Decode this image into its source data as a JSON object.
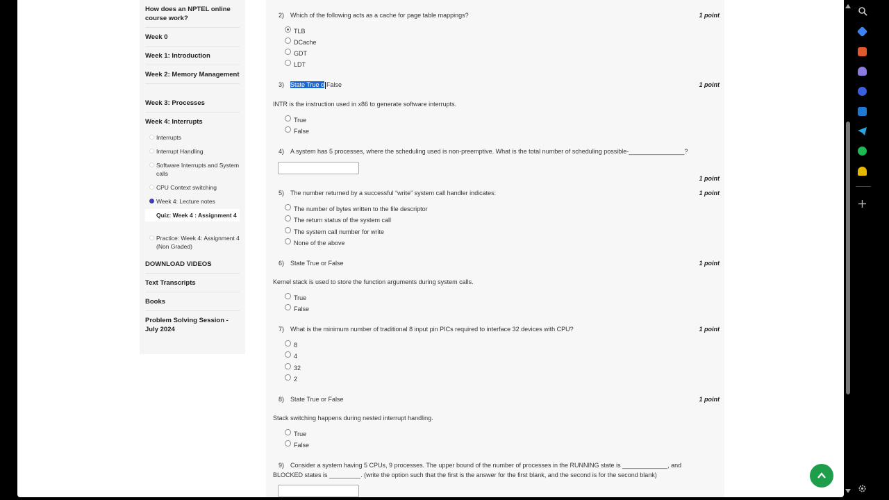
{
  "sidebar": {
    "items": [
      {
        "label": "How does an NPTEL online course work?"
      },
      {
        "label": "Week 0"
      },
      {
        "label": "Week 1: Introduction"
      },
      {
        "label": "Week 2: Memory Management"
      },
      {
        "label": "Week 3: Processes"
      },
      {
        "label": "Week 4: Interrupts"
      }
    ],
    "week4_subitems": [
      {
        "label": "Interrupts"
      },
      {
        "label": "Interrupt Handling"
      },
      {
        "label": "Software Interrupts and System calls"
      },
      {
        "label": "CPU Context switching"
      },
      {
        "label": "Week 4: Lecture notes"
      },
      {
        "label": "Quiz: Week 4 : Assignment 4"
      },
      {
        "label": "Practice: Week 4: Assignment 4 (Non Graded)"
      }
    ],
    "bottom_items": [
      {
        "label": "DOWNLOAD VIDEOS"
      },
      {
        "label": "Text Transcripts"
      },
      {
        "label": "Books"
      },
      {
        "label": "Problem Solving Session - July 2024"
      }
    ]
  },
  "questions": [
    {
      "num": "2)",
      "text": "Which of the following acts as a cache for page table mappings?",
      "points": "1 point",
      "options": [
        "TLB",
        "DCache",
        "GDT",
        "LDT"
      ]
    },
    {
      "num": "3)",
      "text_highlight": "State True o",
      "text_rest": "False",
      "points": "1 point",
      "statement": "INTR is the instruction used in x86 to generate software interrupts.",
      "options": [
        "True",
        "False"
      ]
    },
    {
      "num": "4)",
      "text": "A system has 5 processes, where the scheduling used is non-preemptive. What is the total number of scheduling possible-________________?",
      "points": "1 point"
    },
    {
      "num": "5)",
      "text": "The number returned by a successful “write” system call handler indicates:",
      "points": "1 point",
      "options": [
        "The number of bytes written to the file descriptor",
        "The return status of the system call",
        "The system call number for write",
        "None of the above"
      ]
    },
    {
      "num": "6)",
      "text": "State True or False",
      "points": "1 point",
      "statement": "Kernel stack is used to store the function arguments during system calls.",
      "options": [
        "True",
        "False"
      ]
    },
    {
      "num": "7)",
      "text": "What is the minimum number of traditional 8 input pin PICs required to interface 32 devices with CPU?",
      "points": "1 point",
      "options": [
        "8",
        "4",
        "32",
        "2"
      ]
    },
    {
      "num": "8)",
      "text": "State True or False",
      "points": "1 point",
      "statement": "Stack switching happens during nested interrupt handling.",
      "options": [
        "True",
        "False"
      ]
    },
    {
      "num": "9)",
      "text": "Consider a system having 5 CPUs, 9 processes. The upper bound of the number of processes in the RUNNING state is _____________, and",
      "text2": "BLOCKED states is _________. (write the option such that the first is the answer for the first blank, and the second is for the second blank)"
    }
  ],
  "colors": {
    "accent": "#3f3fb8",
    "fab": "#1e9e4a",
    "highlight": "#1967d2"
  }
}
